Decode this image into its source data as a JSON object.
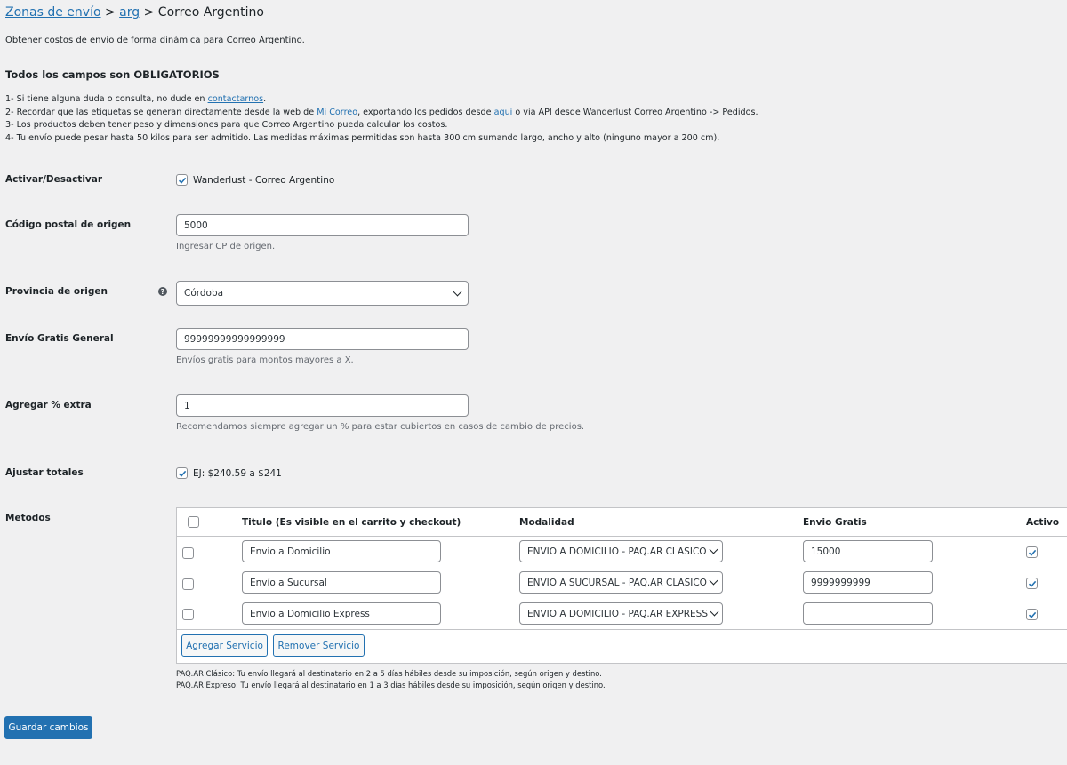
{
  "breadcrumb": {
    "link1": "Zonas de envío",
    "sep1": " > ",
    "link2": "arg",
    "rest": " > Correo Argentino"
  },
  "description": "Obtener costos de envío de forma dinámica para Correo Argentino.",
  "required_heading": "Todos los campos son OBLIGATORIOS",
  "notes": {
    "n1_pre": "1- Si tiene alguna duda o consulta, no dude en ",
    "n1_link": "contactarnos",
    "n1_post": ".",
    "n2_pre": "2- Recordar que las etiquetas se generan directamente desde la web de ",
    "n2_link1": "Mi Correo",
    "n2_mid": ", exportando los pedidos desde ",
    "n2_link2": "aqui",
    "n2_post": " o via API desde Wanderlust Correo Argentino -> Pedidos.",
    "n3": "3- Los productos deben tener peso y dimensiones para que Correo Argentino pueda calcular los costos.",
    "n4": "4- Tu envío puede pesar hasta 50 kilos para ser admitido. Las medidas máximas permitidas son hasta 300 cm sumando largo, ancho y alto (ninguno mayor a 200 cm)."
  },
  "fields": {
    "enable": {
      "label": "Activar/Desactivar",
      "checkbox_label": "Wanderlust - Correo Argentino",
      "checked": true
    },
    "postcode": {
      "label": "Código postal de origen",
      "value": "5000",
      "help": "Ingresar CP de origen."
    },
    "province": {
      "label": "Provincia de origen",
      "value": "Córdoba"
    },
    "free_shipping": {
      "label": "Envío Gratis General",
      "value": "99999999999999999",
      "help": "Envíos gratis para montos mayores a X."
    },
    "extra_percent": {
      "label": "Agregar % extra",
      "value": "1",
      "help": "Recomendamos siempre agregar un % para estar cubiertos en casos de cambio de precios."
    },
    "round_totals": {
      "label": "Ajustar totales",
      "checkbox_label": "EJ: $240.59 a $241",
      "checked": true
    },
    "methods_label": "Metodos"
  },
  "methods_table": {
    "headers": {
      "title": "Titulo (Es visible en el carrito y checkout)",
      "mode": "Modalidad",
      "free": "Envio Gratis",
      "active": "Activo"
    },
    "rows": [
      {
        "title": "Envio a Domicilio",
        "mode": "ENVIO A DOMICILIO - PAQ.AR CLASICO",
        "free": "15000",
        "active": true
      },
      {
        "title": "Envío a Sucursal",
        "mode": "ENVIO A SUCURSAL - PAQ.AR CLASICO",
        "free": "9999999999",
        "active": true
      },
      {
        "title": "Envio a Domicilio Express",
        "mode": "ENVIO A DOMICILIO - PAQ.AR EXPRESS",
        "free": "",
        "active": true
      }
    ],
    "add_button": "Agregar Servicio",
    "remove_button": "Remover Servicio"
  },
  "legend": {
    "line1": "PAQ.AR Clásico: Tu envío llegará al destinatario en 2 a 5 días hábiles desde su imposición, según origen y destino.",
    "line2": "PAQ.AR Expreso: Tu envío llegará al destinatario en 1 a 3 días hábiles desde su imposición, según origen y destino."
  },
  "save_button": "Guardar cambios",
  "colors": {
    "accent": "#2271b1",
    "background": "#f0f0f1",
    "text": "#1d2327"
  },
  "icons": {
    "check": "check-icon",
    "help": "help-icon",
    "chevron": "chevron-down-icon"
  }
}
